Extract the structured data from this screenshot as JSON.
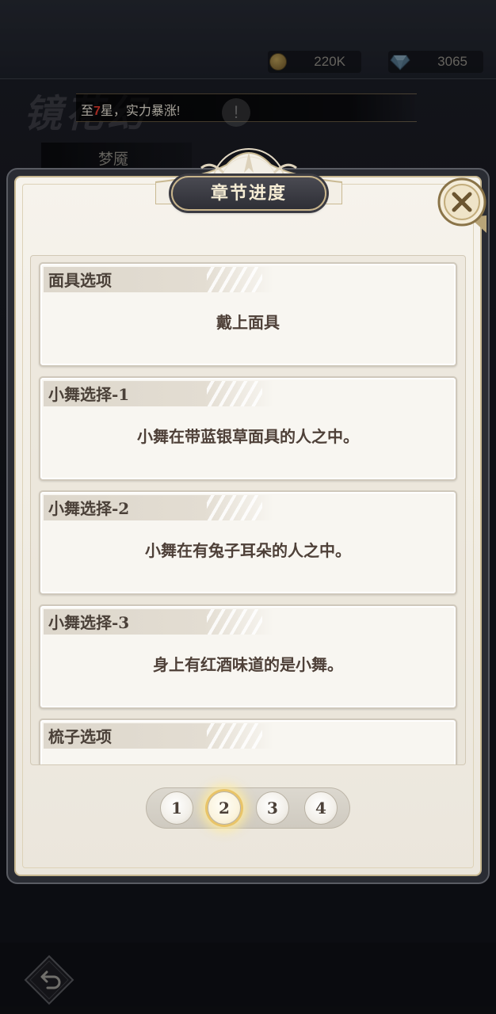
{
  "hud": {
    "gold_value": "220K",
    "gem_value": "3065"
  },
  "background": {
    "banner_title": "镜花幻",
    "notice_prefix": "至",
    "notice_highlight": "7",
    "notice_suffix": "星，实力暴涨!",
    "info_icon_glyph": "!",
    "sub_tab_label": "梦魇"
  },
  "dialog": {
    "title": "章节进度",
    "close_glyph": "✕",
    "items": [
      {
        "title": "面具选项",
        "content": "戴上面具"
      },
      {
        "title": "小舞选择-1",
        "content": "小舞在带蓝银草面具的人之中。"
      },
      {
        "title": "小舞选择-2",
        "content": "小舞在有兔子耳朵的人之中。"
      },
      {
        "title": "小舞选择-3",
        "content": "身上有红酒味道的是小舞。"
      },
      {
        "title": "梳子选项",
        "content": ""
      }
    ],
    "pagination": {
      "pages": [
        "1",
        "2",
        "3",
        "4"
      ],
      "current": "2"
    }
  },
  "colors": {
    "accent_gold": "#c8b48a",
    "highlight_red": "#e23b2e",
    "panel_bg": "#f3efe6",
    "text_brown": "#4a4038"
  },
  "icons": [
    "coin-icon",
    "diamond-icon",
    "info-icon",
    "close-icon",
    "back-arrow-icon"
  ]
}
